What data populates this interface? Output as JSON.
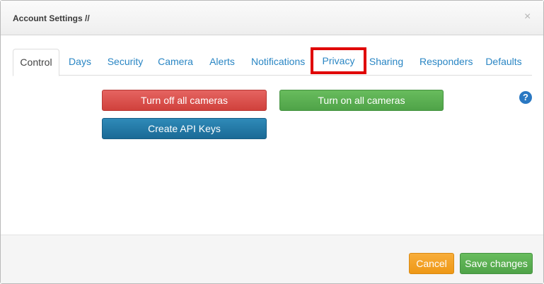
{
  "modal": {
    "title": "Account Settings //",
    "close_glyph": "×"
  },
  "tabs": [
    {
      "label": "Control",
      "active": true
    },
    {
      "label": "Days"
    },
    {
      "label": "Security"
    },
    {
      "label": "Camera"
    },
    {
      "label": "Alerts"
    },
    {
      "label": "Notifications"
    },
    {
      "label": "Privacy",
      "highlighted": true
    },
    {
      "label": "Sharing"
    },
    {
      "label": "Responders"
    },
    {
      "label": "Defaults"
    }
  ],
  "control": {
    "turn_off_label": "Turn off all cameras",
    "turn_on_label": "Turn on all cameras",
    "api_keys_label": "Create API Keys",
    "help_glyph": "?"
  },
  "footer": {
    "cancel_label": "Cancel",
    "save_label": "Save changes"
  },
  "colors": {
    "link": "#2a86c4",
    "highlight": "#e00000",
    "danger": "#d0413c",
    "success": "#4fa348",
    "primary": "#1a6a96",
    "warning": "#ee9816"
  }
}
